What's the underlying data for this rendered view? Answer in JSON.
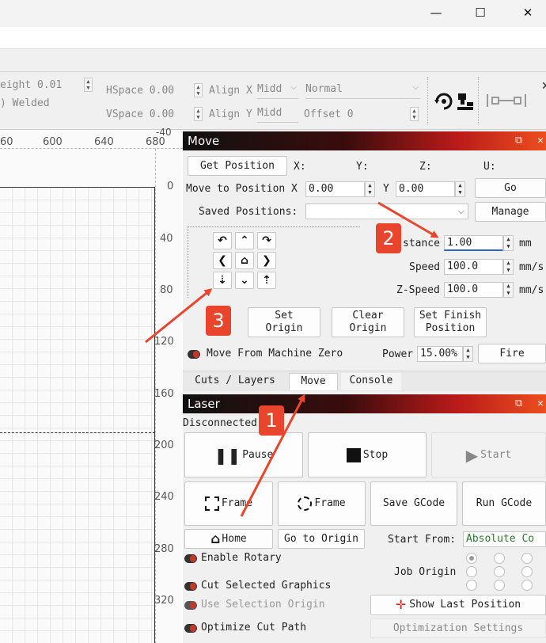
{
  "window": {
    "minimize": "—",
    "maximize": "☐",
    "close": "✕"
  },
  "toolbar": {
    "height_label": "eight 0.01",
    "welded_label": "Welded",
    "hspace_label": "HSpace 0.00",
    "vspace_label": "VSpace 0.00",
    "alignx_label": "Align X",
    "alignx_value": "Midd",
    "aligny_label": "Align Y",
    "aligny_value": "Midd",
    "mode_value": "Normal",
    "offset_label": "Offset 0"
  },
  "ruler": {
    "top_ticks": [
      "60",
      "600",
      "640",
      "680"
    ],
    "top_corner": "-40",
    "left_ticks": [
      "0",
      "40",
      "80",
      "120",
      "160",
      "200",
      "240",
      "280",
      "320"
    ]
  },
  "move_panel": {
    "title": "Move",
    "get_position": "Get Position",
    "x_label": "X:",
    "y_label": "Y:",
    "z_label": "Z:",
    "u_label": "U:",
    "move_to_label": "Move to Position X",
    "move_x": "0.00",
    "move_y_label": "Y",
    "move_y": "0.00",
    "go": "Go",
    "saved_label": "Saved Positions:",
    "manage": "Manage",
    "distance_label": "stance",
    "distance_value": "1.00",
    "distance_unit": "mm",
    "speed_label": "Speed",
    "speed_value": "100.0",
    "speed_unit": "mm/s",
    "zspeed_label": "Z-Speed",
    "zspeed_value": "100.0",
    "zspeed_unit": "mm/s",
    "set_origin": "Set\nOrigin",
    "clear_origin": "Clear\nOrigin",
    "set_finish": "Set Finish\nPosition",
    "move_from_zero": "Move From Machine Zero",
    "power_label": "Power",
    "power_value": "15.00%",
    "fire": "Fire"
  },
  "tabs": [
    "Cuts / Layers",
    "Move",
    "Console"
  ],
  "laser_panel": {
    "title": "Laser",
    "status": "Disconnected",
    "pause": "Pause",
    "stop": "Stop",
    "start": "Start",
    "frame1": "Frame",
    "frame2": "Frame",
    "save_gcode": "Save GCode",
    "run_gcode": "Run GCode",
    "home": "Home",
    "go_to_origin": "Go to Origin",
    "start_from_label": "Start From:",
    "start_from_value": "Absolute Co",
    "enable_rotary": "Enable Rotary",
    "job_origin_label": "Job Origin",
    "cut_selected": "Cut Selected Graphics",
    "use_selection_origin": "Use Selection Origin",
    "show_last_position": "Show Last Position",
    "optimize_cut_path": "Optimize Cut Path",
    "optimization_settings": "Optimization Settings"
  },
  "annotations": {
    "badge1": "1",
    "badge2": "2",
    "badge3": "3",
    "color": "#e8452c"
  }
}
